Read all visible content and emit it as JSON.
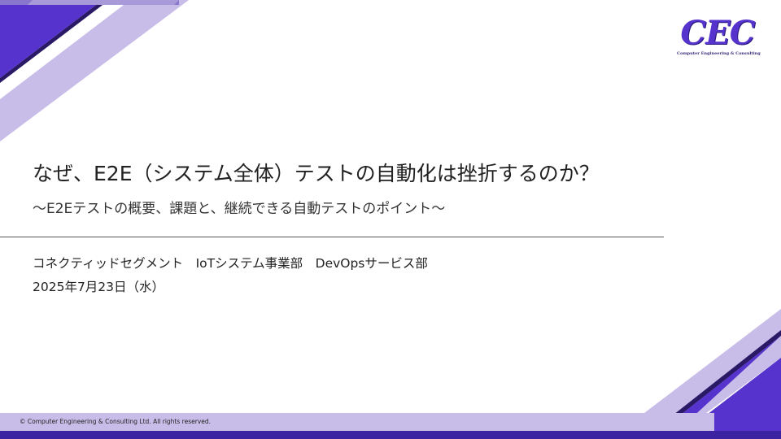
{
  "slide": {
    "title": "なぜ、E2E（システム全体）テストの自動化は挫折するのか？",
    "subtitle": "～E2Eテストの概要、課題と、継続できる自動テストのポイント～",
    "organization": "コネクティッドセグメント　IoTシステム事業部　DevOpsサービス部",
    "date": "2025年7月23日（水）"
  },
  "logo": {
    "text": "CEC",
    "tagline": "Computer Engineering & Consulting"
  },
  "footer": {
    "copyright": "© Computer Engineering & Consulting Ltd. All rights reserved."
  },
  "colors": {
    "brand": "#5533cc",
    "dark_purple": "#2a1a66",
    "light_lavender": "#c7bde8",
    "mid_lavender": "#a89ad8"
  }
}
